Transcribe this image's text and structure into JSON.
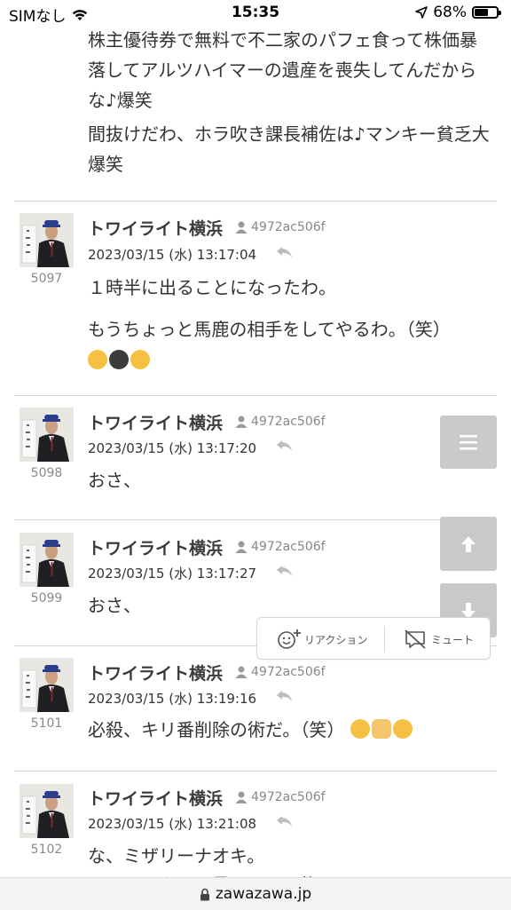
{
  "status": {
    "carrier": "SIMなし",
    "time": "15:35",
    "battery": "68%",
    "battery_level": 0.68
  },
  "top_text": {
    "para1": "株主優待券で無料で不二家のパフェ食って株価暴落してアルツハイマーの遺産を喪失してんだからな♪爆笑",
    "para2": "間抜けだわ、ホラ吹き課長補佐は♪マンキー貧乏大爆笑"
  },
  "posts": [
    {
      "name": "トワイライト横浜",
      "id": "4972ac506f",
      "date": "2023/03/15 (水) 13:17:04",
      "number": "5097",
      "lines": [
        "１時半に出ることになったわ。",
        "もうちょっと馬鹿の相手をしてやるわ。（笑）"
      ]
    },
    {
      "name": "トワイライト横浜",
      "id": "4972ac506f",
      "date": "2023/03/15 (水) 13:17:20",
      "number": "5098",
      "lines": [
        "おさ、"
      ]
    },
    {
      "name": "トワイライト横浜",
      "id": "4972ac506f",
      "date": "2023/03/15 (水) 13:17:27",
      "number": "5099",
      "lines": [
        "おさ、"
      ]
    },
    {
      "name": "トワイライト横浜",
      "id": "4972ac506f",
      "date": "2023/03/15 (水) 13:19:16",
      "number": "5101",
      "lines": [
        "必殺、キリ番削除の術だ。（笑）"
      ]
    },
    {
      "name": "トワイライト横浜",
      "id": "4972ac506f",
      "date": "2023/03/15 (水) 13:21:08",
      "number": "5102",
      "lines": [
        "な、ミザリーナオキ。",
        "これ…ルタから見てると間抜けだろ"
      ]
    }
  ],
  "reaction_popup": {
    "reaction_label": "リアクション",
    "mute_label": "ミュート"
  },
  "url": "zawazawa.jp",
  "icons": {
    "menu": "menu-icon",
    "up": "arrow-up-icon",
    "down": "arrow-down-icon",
    "reply": "reply-icon",
    "user": "user-icon"
  }
}
